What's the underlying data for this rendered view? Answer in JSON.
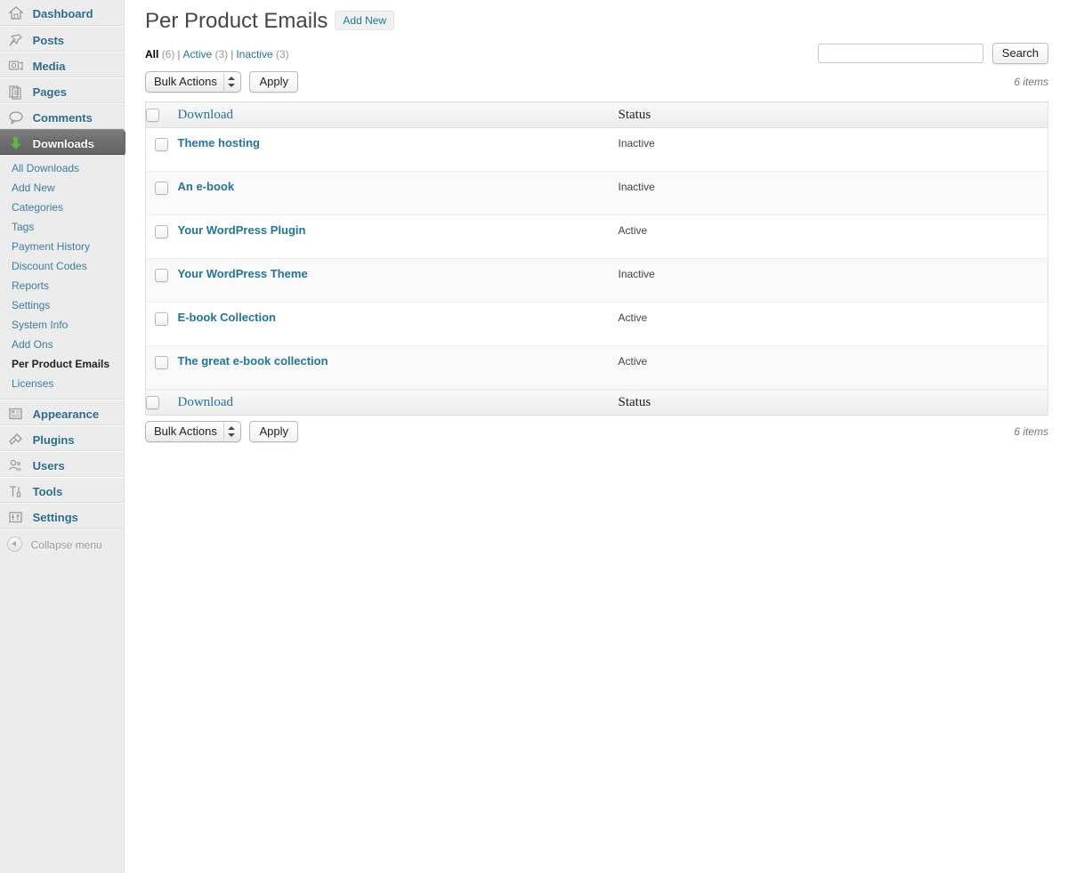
{
  "sidebar": {
    "menu": [
      {
        "label": "Dashboard",
        "icon": "dashboard-icon",
        "current": false
      },
      {
        "label": "Posts",
        "icon": "pin-icon",
        "current": false
      },
      {
        "label": "Media",
        "icon": "media-icon",
        "current": false
      },
      {
        "label": "Pages",
        "icon": "pages-icon",
        "current": false
      },
      {
        "label": "Comments",
        "icon": "comment-icon",
        "current": false
      },
      {
        "label": "Downloads",
        "icon": "download-arrow-icon",
        "current": true
      }
    ],
    "submenu": [
      {
        "label": "All Downloads",
        "current": false
      },
      {
        "label": "Add New",
        "current": false
      },
      {
        "label": "Categories",
        "current": false
      },
      {
        "label": "Tags",
        "current": false
      },
      {
        "label": "Payment History",
        "current": false
      },
      {
        "label": "Discount Codes",
        "current": false
      },
      {
        "label": "Reports",
        "current": false
      },
      {
        "label": "Settings",
        "current": false
      },
      {
        "label": "System Info",
        "current": false
      },
      {
        "label": "Add Ons",
        "current": false
      },
      {
        "label": "Per Product Emails",
        "current": true
      },
      {
        "label": "Licenses",
        "current": false
      }
    ],
    "menu_lower": [
      {
        "label": "Appearance",
        "icon": "appearance-icon"
      },
      {
        "label": "Plugins",
        "icon": "plugin-icon"
      },
      {
        "label": "Users",
        "icon": "users-icon"
      },
      {
        "label": "Tools",
        "icon": "tools-icon"
      },
      {
        "label": "Settings",
        "icon": "settings-icon"
      }
    ],
    "collapse_label": "Collapse menu"
  },
  "page": {
    "title": "Per Product Emails",
    "add_new_label": "Add New"
  },
  "filters": [
    {
      "label": "All",
      "count": "(6)",
      "current": true
    },
    {
      "label": "Active",
      "count": "(3)",
      "current": false
    },
    {
      "label": "Inactive",
      "count": "(3)",
      "current": false
    }
  ],
  "filter_separator": "|",
  "search": {
    "value": "",
    "placeholder": "",
    "button_label": "Search"
  },
  "tablenav_top": {
    "bulk_actions_label": "Bulk Actions",
    "apply_label": "Apply",
    "displaying_num": "6 items"
  },
  "tablenav_bottom": {
    "bulk_actions_label": "Bulk Actions",
    "apply_label": "Apply",
    "displaying_num": "6 items"
  },
  "table": {
    "columns": {
      "name": "Download",
      "status": "Status"
    },
    "rows": [
      {
        "name": "Theme hosting",
        "status": "Inactive"
      },
      {
        "name": "An e-book",
        "status": "Inactive"
      },
      {
        "name": "Your WordPress Plugin",
        "status": "Active"
      },
      {
        "name": "Your WordPress Theme",
        "status": "Inactive"
      },
      {
        "name": "E-book Collection",
        "status": "Active"
      },
      {
        "name": "The great e-book collection",
        "status": "Active"
      }
    ]
  },
  "colors": {
    "link": "#21759b",
    "sidebar_bg": "#ececec",
    "current_menu_bg": "#6d6d6d",
    "download_icon": "#62b245"
  }
}
